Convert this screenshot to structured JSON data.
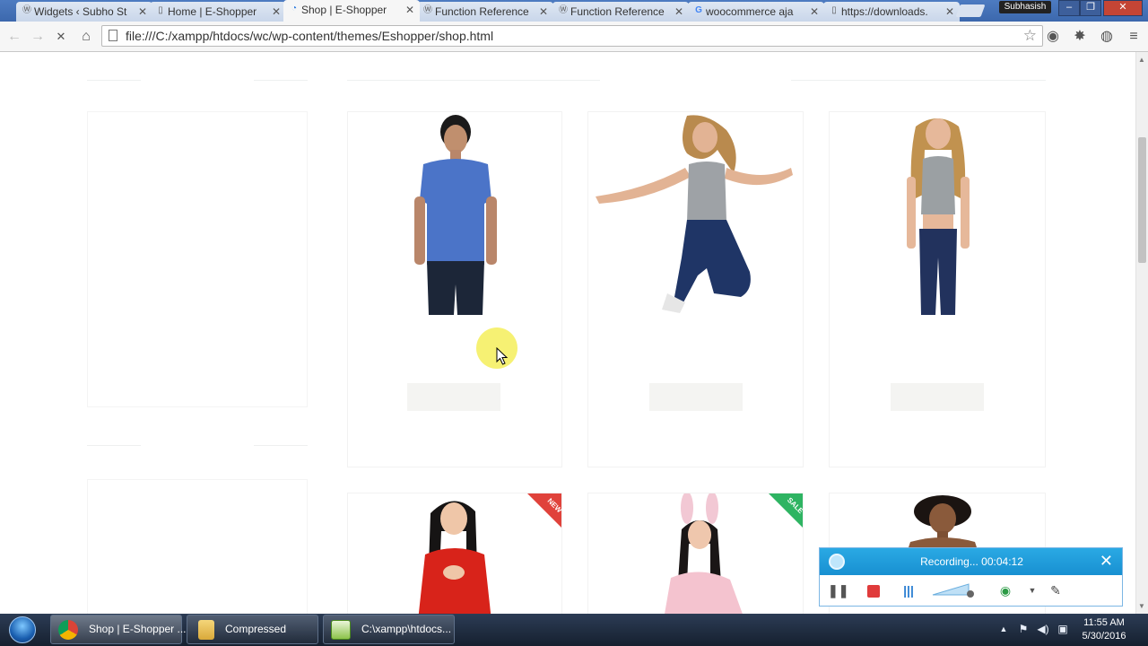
{
  "browser": {
    "tabs": [
      {
        "label": "Widgets ‹ Subho St",
        "icon": "wordpress-icon",
        "active": false
      },
      {
        "label": "Home | E-Shopper",
        "icon": "page-icon",
        "active": false
      },
      {
        "label": "Shop | E-Shopper",
        "icon": "loading-icon",
        "active": true
      },
      {
        "label": "Function Reference",
        "icon": "wordpress-icon",
        "active": false
      },
      {
        "label": "Function Reference",
        "icon": "wordpress-icon",
        "active": false
      },
      {
        "label": "woocommerce aja",
        "icon": "google-icon",
        "active": false
      },
      {
        "label": "https://downloads.",
        "icon": "page-icon",
        "active": false
      }
    ],
    "profile_name": "Subhasish",
    "url": "file:///C:/xampp/htdocs/wc/wp-content/themes/Eshopper/shop.html"
  },
  "products": {
    "row1": [
      {
        "name": "man-blue-polo",
        "colors": {
          "shirt": "#4b74c8",
          "pants": "#1c2638"
        }
      },
      {
        "name": "woman-jumping",
        "colors": {
          "shirt": "#9ea2a6",
          "pants": "#1f3566"
        }
      },
      {
        "name": "woman-standing",
        "colors": {
          "shirt": "#9ba0a3",
          "pants": "#22325d"
        }
      }
    ],
    "row2": [
      {
        "name": "woman-red-dress",
        "badge": "NEW",
        "badge_color": "#e0423b"
      },
      {
        "name": "woman-bunny",
        "badge": "SALE",
        "badge_color": "#2eb462"
      },
      {
        "name": "woman-curly-hair",
        "badge": ""
      }
    ]
  },
  "recorder": {
    "status": "Recording... 00:04:12",
    "accent": "#1f9ad8"
  },
  "taskbar": {
    "items": [
      {
        "label": "Shop | E-Shopper ...",
        "icon": "chrome-icon"
      },
      {
        "label": "Compressed",
        "icon": "folder-icon"
      },
      {
        "label": "C:\\xampp\\htdocs...",
        "icon": "notepad-icon"
      }
    ],
    "time": "11:55 AM",
    "date": "5/30/2016"
  }
}
